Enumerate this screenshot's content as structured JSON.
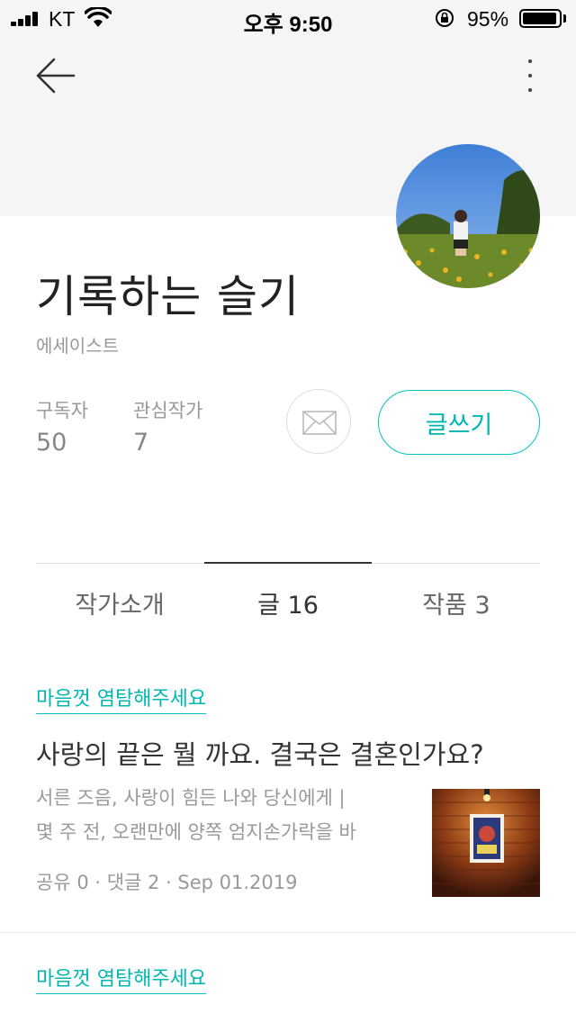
{
  "status_bar": {
    "carrier": "KT",
    "time": "오후 9:50",
    "battery_percent": "95%",
    "battery_level": 0.95
  },
  "nav": {
    "back_icon": "arrow-left-icon",
    "more_icon": "more-vertical-icon"
  },
  "profile": {
    "name": "기록하는 슬기",
    "role": "에세이스트",
    "subscribers_label": "구독자",
    "subscribers_count": "50",
    "following_label": "관심작가",
    "following_count": "7",
    "mail_icon": "mail-icon",
    "write_button_label": "글쓰기"
  },
  "tabs": [
    {
      "label": "작가소개",
      "active": false
    },
    {
      "label": "글 16",
      "active": true
    },
    {
      "label": "작품 3",
      "active": false
    }
  ],
  "articles": [
    {
      "tag": "마음껏 염탐해주세요",
      "title": "사랑의 끝은 뭘 까요. 결국은 결혼인가요?",
      "excerpt_line1": "서른 즈음, 사랑이 힘든 나와 당신에게 |",
      "excerpt_line2": "몇 주 전, 오랜만에 양쪽 엄지손가락을 바",
      "meta": "공유 0 · 댓글 2 · Sep 01.2019"
    },
    {
      "tag": "마음껏 염탐해주세요"
    }
  ],
  "colors": {
    "accent": "#00b7b0",
    "header_band": "#f5f5f5"
  }
}
